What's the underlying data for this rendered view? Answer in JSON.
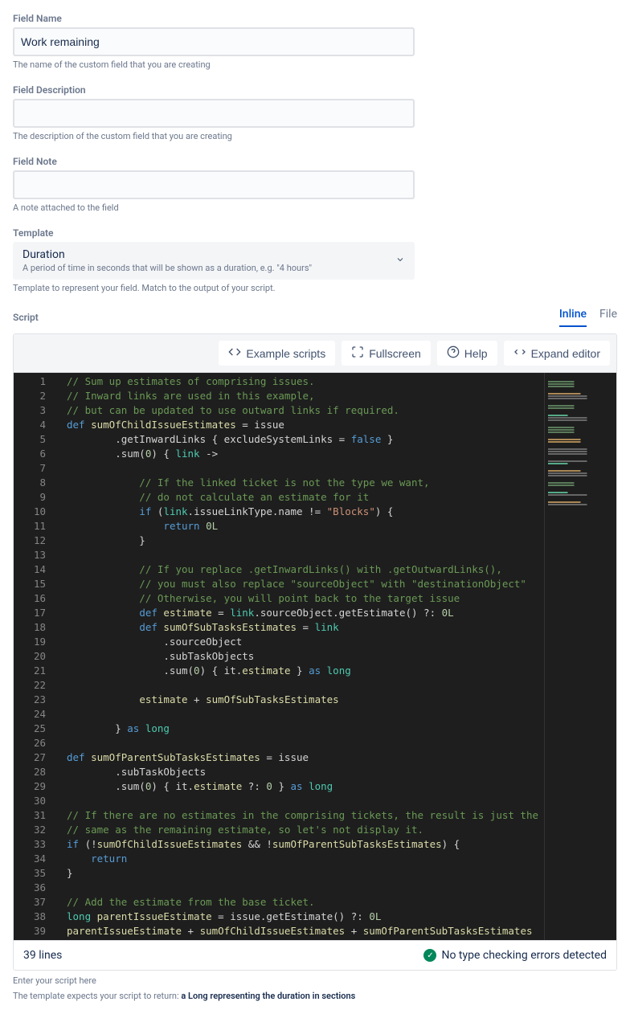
{
  "fieldName": {
    "label": "Field Name",
    "value": "Work remaining",
    "help": "The name of the custom field that you are creating"
  },
  "fieldDescription": {
    "label": "Field Description",
    "value": "",
    "help": "The description of the custom field that you are creating"
  },
  "fieldNote": {
    "label": "Field Note",
    "value": "",
    "help": "A note attached to the field"
  },
  "template": {
    "label": "Template",
    "selected": "Duration",
    "description": "A period of time in seconds that will be shown as a duration, e.g. \"4 hours\"",
    "help": "Template to represent your field. Match to the output of your script."
  },
  "script": {
    "label": "Script",
    "tabs": {
      "inline": "Inline",
      "file": "File"
    },
    "toolbar": {
      "example": "Example scripts",
      "fullscreen": "Fullscreen",
      "help": "Help",
      "expand": "Expand editor"
    },
    "lines": [
      "// Sum up estimates of comprising issues.",
      "// Inward links are used in this example,",
      "// but can be updated to use outward links if required.",
      "def sumOfChildIssueEstimates = issue",
      "        .getInwardLinks { excludeSystemLinks = false }",
      "        .sum(0) { link ->",
      "",
      "            // If the linked ticket is not the type we want,",
      "            // do not calculate an estimate for it",
      "            if (link.issueLinkType.name != \"Blocks\") {",
      "                return 0L",
      "            }",
      "",
      "            // If you replace .getInwardLinks() with .getOutwardLinks(),",
      "            // you must also replace \"sourceObject\" with \"destinationObject\"",
      "            // Otherwise, you will point back to the target issue",
      "            def estimate = link.sourceObject.getEstimate() ?: 0L",
      "            def sumOfSubTasksEstimates = link",
      "                .sourceObject",
      "                .subTaskObjects",
      "                .sum(0) { it.estimate } as long",
      "",
      "            estimate + sumOfSubTasksEstimates",
      "",
      "        } as long",
      "",
      "def sumOfParentSubTasksEstimates = issue",
      "        .subTaskObjects",
      "        .sum(0) { it.estimate ?: 0 } as long",
      "",
      "// If there are no estimates in the comprising tickets, the result is just the",
      "// same as the remaining estimate, so let's not display it.",
      "if (!sumOfChildIssueEstimates && !sumOfParentSubTasksEstimates) {",
      "    return",
      "}",
      "",
      "// Add the estimate from the base ticket.",
      "long parentIssueEstimate = issue.getEstimate() ?: 0L",
      "parentIssueEstimate + sumOfChildIssueEstimates + sumOfParentSubTasksEstimates"
    ],
    "statusLeft": "39 lines",
    "statusRight": "No type checking errors detected",
    "footerHelp": "Enter your script here",
    "footerReturn": "The template expects your script to return: ",
    "footerReturnBold": "a Long representing the duration in sections"
  }
}
